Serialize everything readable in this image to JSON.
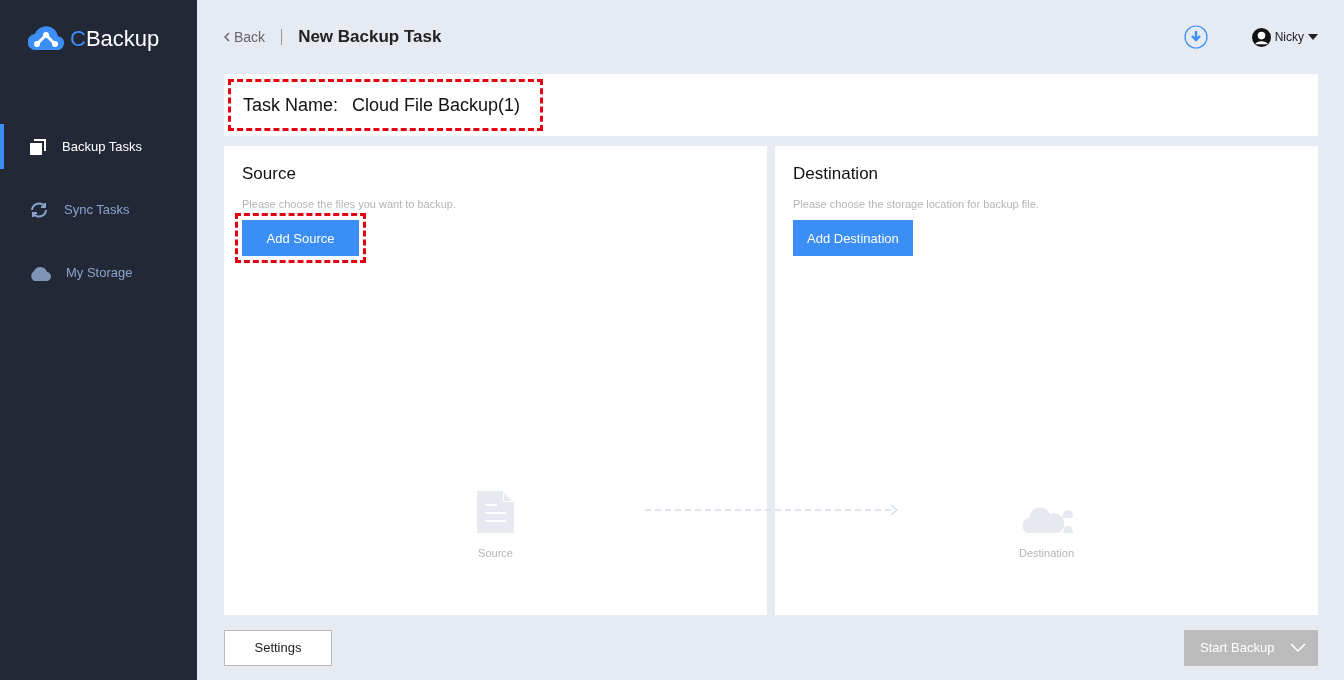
{
  "app": {
    "logo_text": "Backup",
    "logo_initial": "C"
  },
  "sidebar": {
    "items": [
      {
        "label": "Backup Tasks",
        "kind": "tasks",
        "selected": true
      },
      {
        "label": "Sync Tasks",
        "kind": "sync",
        "selected": false
      },
      {
        "label": "My Storage",
        "kind": "storage",
        "selected": false
      }
    ]
  },
  "header": {
    "back": "Back",
    "title": "New Backup Task",
    "user": "Nicky"
  },
  "task_name": {
    "label": "Task Name:",
    "value": "Cloud File Backup(1)",
    "highlighted": true
  },
  "panels": [
    {
      "kind": "source",
      "title": "Source",
      "hint": "Please choose the files you want to backup.",
      "button": "Add Source",
      "highlighted": true,
      "caption": "Source"
    },
    {
      "kind": "destination",
      "title": "Destination",
      "hint": "Please choose the storage location for backup file.",
      "button": "Add Destination",
      "highlighted": false,
      "caption": "Destination"
    }
  ],
  "footer": {
    "settings": "Settings",
    "start": "Start Backup",
    "start_disabled": true
  }
}
